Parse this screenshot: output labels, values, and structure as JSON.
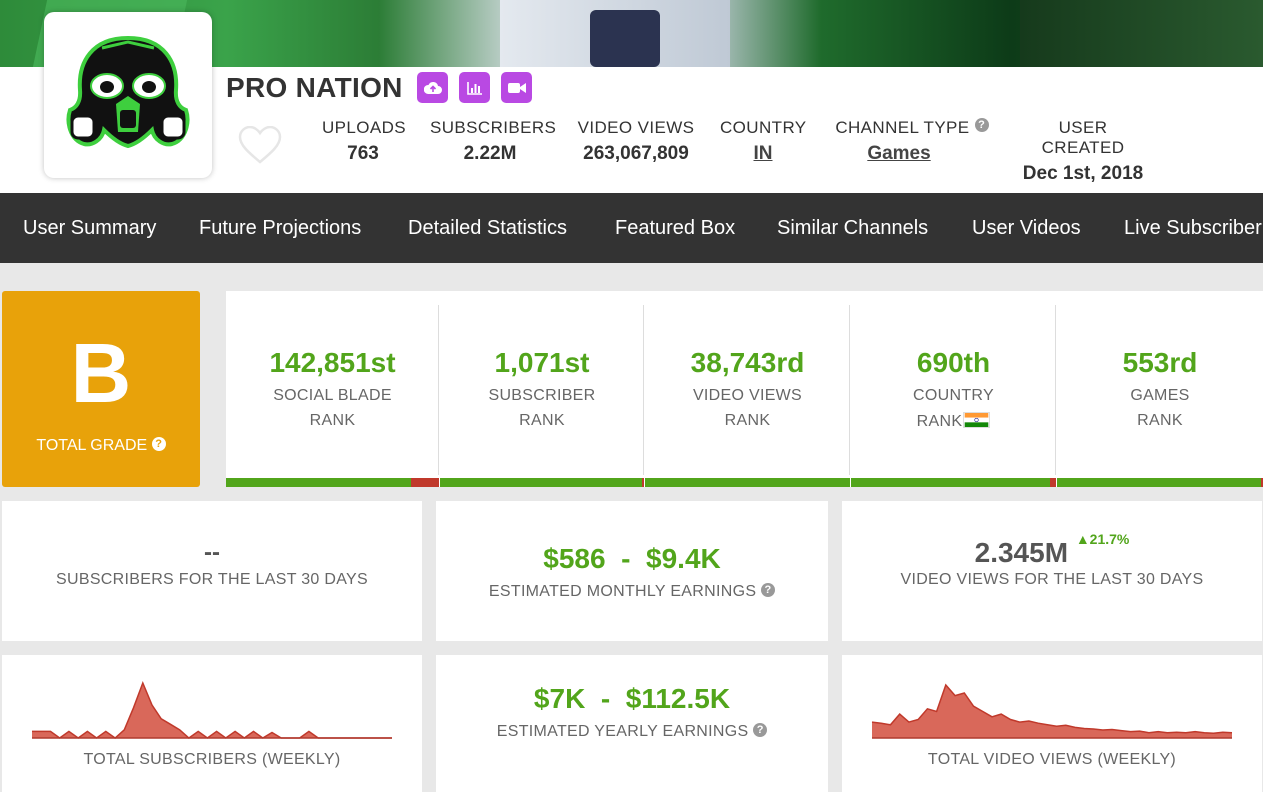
{
  "channel": {
    "name": "PRO NATION",
    "avatar_icon": "gas-mask-skull-logo"
  },
  "header_icons": [
    "upload-cloud-icon",
    "bar-chart-icon",
    "video-camera-icon"
  ],
  "stats": {
    "uploads_label": "UPLOADS",
    "uploads_value": "763",
    "subscribers_label": "SUBSCRIBERS",
    "subscribers_value": "2.22M",
    "views_label": "VIDEO VIEWS",
    "views_value": "263,067,809",
    "country_label": "COUNTRY",
    "country_value": "IN",
    "channel_type_label": "CHANNEL TYPE",
    "channel_type_value": "Games",
    "created_label": "USER CREATED",
    "created_value": "Dec 1st, 2018",
    "help": "?"
  },
  "nav": [
    "User Summary",
    "Future Projections",
    "Detailed Statistics",
    "Featured Box",
    "Similar Channels",
    "User Videos",
    "Live Subscriber"
  ],
  "grade": {
    "letter": "B",
    "label": "TOTAL GRADE",
    "help": "?"
  },
  "ranks": [
    {
      "value": "142,851st",
      "line1": "SOCIAL BLADE",
      "line2": "RANK",
      "bar_fill": 0.87
    },
    {
      "value": "1,071st",
      "line1": "SUBSCRIBER",
      "line2": "RANK",
      "bar_fill": 0.99
    },
    {
      "value": "38,743rd",
      "line1": "VIDEO VIEWS",
      "line2": "RANK",
      "bar_fill": 1.0
    },
    {
      "value": "690th",
      "line1": "COUNTRY",
      "line2": "RANK",
      "bar_fill": 0.97
    },
    {
      "value": "553rd",
      "line1": "GAMES",
      "line2": "RANK",
      "bar_fill": 0.99
    }
  ],
  "cards": {
    "subs_30": {
      "value": "--",
      "label": "SUBSCRIBERS FOR THE LAST 30 DAYS"
    },
    "monthly": {
      "low": "$586",
      "sep": "-",
      "high": "$9.4K",
      "label": "ESTIMATED MONTHLY EARNINGS",
      "help": "?"
    },
    "views_30": {
      "value": "2.345M",
      "change": "21.7%",
      "label": "VIDEO VIEWS FOR THE LAST 30 DAYS"
    },
    "yearly": {
      "low": "$7K",
      "sep": "-",
      "high": "$112.5K",
      "label": "ESTIMATED YEARLY EARNINGS",
      "help": "?"
    },
    "subs_weekly": {
      "label": "TOTAL SUBSCRIBERS (WEEKLY)"
    },
    "views_weekly": {
      "label": "TOTAL VIDEO VIEWS (WEEKLY)"
    }
  },
  "colors": {
    "accent_green": "#52a51b",
    "grade_orange": "#e8a20a",
    "icon_purple": "#b949e3",
    "nav_bg": "#333333",
    "spark_red": "#c0392b"
  },
  "chart_data": [
    {
      "type": "area",
      "title": "TOTAL SUBSCRIBERS (WEEKLY)",
      "values": [
        0.12,
        0.12,
        0.12,
        0.0,
        0.12,
        0.0,
        0.12,
        0.0,
        0.12,
        0.0,
        0.15,
        0.55,
        1.0,
        0.6,
        0.35,
        0.25,
        0.15,
        0.0,
        0.12,
        0.0,
        0.12,
        0.0,
        0.12,
        0.0,
        0.12,
        0.0,
        0.1,
        0.0,
        0.0,
        0.0,
        0.12,
        0.0,
        0.0,
        0.0,
        0.0,
        0.0,
        0.0,
        0.0,
        0.0,
        0.0
      ]
    },
    {
      "type": "area",
      "title": "TOTAL VIDEO VIEWS (WEEKLY)",
      "values": [
        0.3,
        0.28,
        0.25,
        0.45,
        0.3,
        0.35,
        0.55,
        0.5,
        1.0,
        0.8,
        0.85,
        0.6,
        0.5,
        0.4,
        0.45,
        0.35,
        0.3,
        0.32,
        0.28,
        0.25,
        0.22,
        0.24,
        0.2,
        0.18,
        0.17,
        0.15,
        0.16,
        0.14,
        0.12,
        0.13,
        0.1,
        0.12,
        0.1,
        0.11,
        0.1,
        0.12,
        0.1,
        0.09,
        0.11,
        0.1
      ]
    }
  ]
}
